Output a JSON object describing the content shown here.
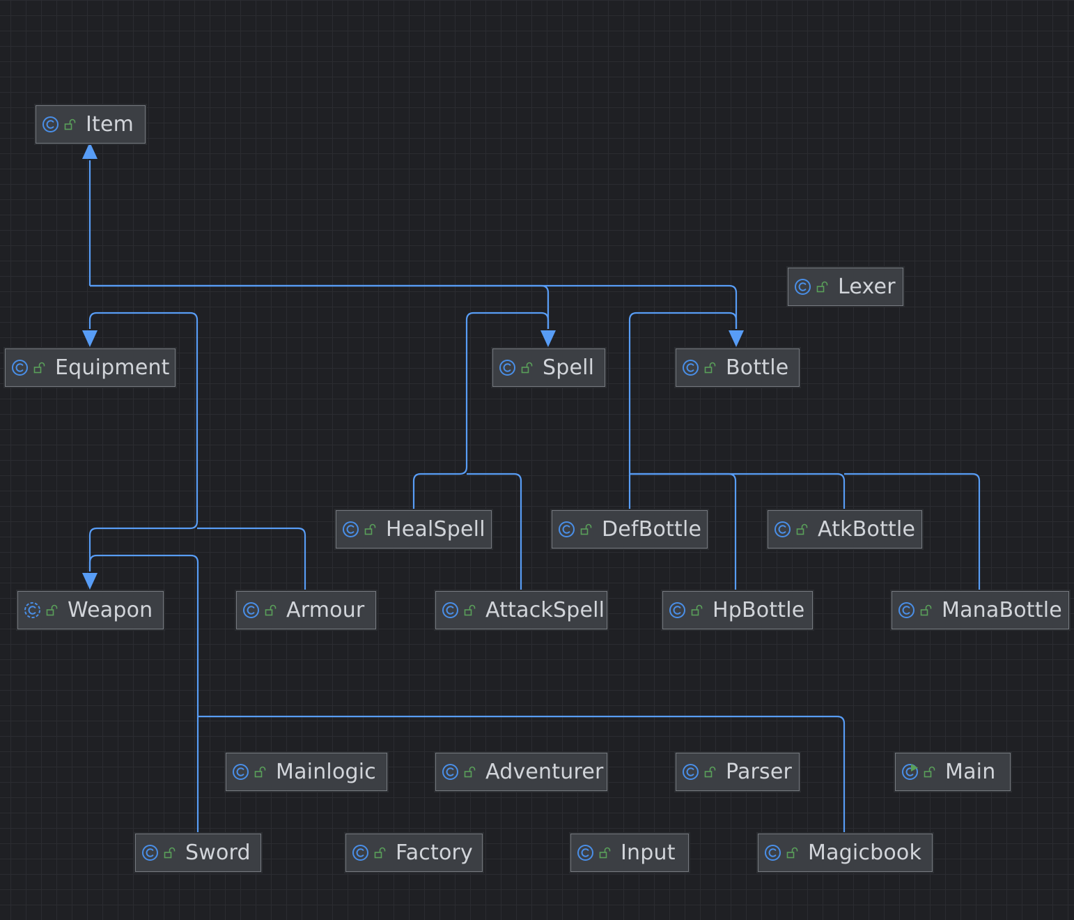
{
  "diagram": {
    "nodes": [
      {
        "id": "Item",
        "label": "Item",
        "icon": "class-icon"
      },
      {
        "id": "Lexer",
        "label": "Lexer",
        "icon": "class-icon"
      },
      {
        "id": "Equipment",
        "label": "Equipment",
        "icon": "class-icon"
      },
      {
        "id": "Spell",
        "label": "Spell",
        "icon": "class-icon"
      },
      {
        "id": "Bottle",
        "label": "Bottle",
        "icon": "class-icon"
      },
      {
        "id": "HealSpell",
        "label": "HealSpell",
        "icon": "class-icon"
      },
      {
        "id": "DefBottle",
        "label": "DefBottle",
        "icon": "class-icon"
      },
      {
        "id": "AtkBottle",
        "label": "AtkBottle",
        "icon": "class-icon"
      },
      {
        "id": "Weapon",
        "label": "Weapon",
        "icon": "abstract-class-icon"
      },
      {
        "id": "Armour",
        "label": "Armour",
        "icon": "class-icon"
      },
      {
        "id": "AttackSpell",
        "label": "AttackSpell",
        "icon": "class-icon"
      },
      {
        "id": "HpBottle",
        "label": "HpBottle",
        "icon": "class-icon"
      },
      {
        "id": "ManaBottle",
        "label": "ManaBottle",
        "icon": "class-icon"
      },
      {
        "id": "Mainlogic",
        "label": "Mainlogic",
        "icon": "class-icon"
      },
      {
        "id": "Adventurer",
        "label": "Adventurer",
        "icon": "class-icon"
      },
      {
        "id": "Parser",
        "label": "Parser",
        "icon": "class-icon"
      },
      {
        "id": "Main",
        "label": "Main",
        "icon": "runnable-class-icon"
      },
      {
        "id": "Sword",
        "label": "Sword",
        "icon": "class-icon"
      },
      {
        "id": "Factory",
        "label": "Factory",
        "icon": "class-icon"
      },
      {
        "id": "Input",
        "label": "Input",
        "icon": "class-icon"
      },
      {
        "id": "Magicbook",
        "label": "Magicbook",
        "icon": "class-icon"
      }
    ],
    "edges": [
      {
        "from": "Equipment",
        "to": "Item",
        "type": "extends"
      },
      {
        "from": "Spell",
        "to": "Item",
        "type": "extends"
      },
      {
        "from": "Bottle",
        "to": "Item",
        "type": "extends"
      },
      {
        "from": "Weapon",
        "to": "Equipment",
        "type": "extends"
      },
      {
        "from": "Armour",
        "to": "Equipment",
        "type": "extends"
      },
      {
        "from": "HealSpell",
        "to": "Spell",
        "type": "extends"
      },
      {
        "from": "AttackSpell",
        "to": "Spell",
        "type": "extends"
      },
      {
        "from": "DefBottle",
        "to": "Bottle",
        "type": "extends"
      },
      {
        "from": "AtkBottle",
        "to": "Bottle",
        "type": "extends"
      },
      {
        "from": "HpBottle",
        "to": "Bottle",
        "type": "extends"
      },
      {
        "from": "ManaBottle",
        "to": "Bottle",
        "type": "extends"
      },
      {
        "from": "Sword",
        "to": "Weapon",
        "type": "extends"
      },
      {
        "from": "Magicbook",
        "to": "Weapon",
        "type": "extends"
      }
    ],
    "colors": {
      "background": "#1f2024",
      "grid": "#2b2c31",
      "edge": "#589df6",
      "node_fill": "#3c3f44",
      "node_border": "#777b81",
      "class_icon": "#4a8fe8",
      "visibility_icon": "#5aa05a",
      "run_icon": "#5aa05a",
      "label": "#d2d5da"
    }
  }
}
